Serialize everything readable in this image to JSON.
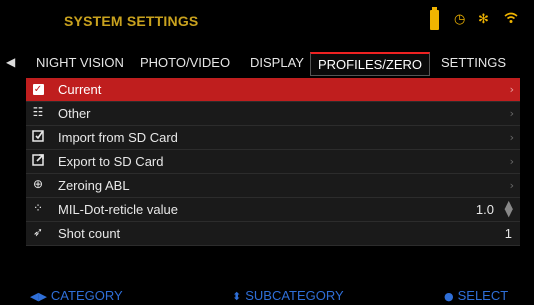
{
  "header": {
    "title": "SYSTEM SETTINGS",
    "icons": [
      "battery-icon",
      "timer-icon",
      "bluetooth-icon",
      "wifi-icon"
    ],
    "accent_color": "#f0b400"
  },
  "tabs": [
    {
      "label": "NIGHT VISION"
    },
    {
      "label": "PHOTO/VIDEO"
    },
    {
      "label": "DISPLAY"
    },
    {
      "label": "PROFILES/ZERO",
      "active": true
    },
    {
      "label": "SETTINGS"
    }
  ],
  "list": {
    "items": [
      {
        "label": "Current",
        "icon": "check-icon",
        "selected": true
      },
      {
        "label": "Other",
        "icon": "list-icon"
      },
      {
        "label": "Import from SD Card",
        "icon": "import-icon"
      },
      {
        "label": "Export to SD Card",
        "icon": "export-icon"
      },
      {
        "label": "Zeroing ABL",
        "icon": "zeroing-icon"
      },
      {
        "label": "MIL-Dot-reticle value",
        "icon": "reticle-icon",
        "value": "1.0"
      },
      {
        "label": "Shot count",
        "icon": "shot-count-icon",
        "value": "1"
      }
    ]
  },
  "footer": {
    "category": "CATEGORY",
    "subcategory": "SUBCATEGORY",
    "select": "SELECT",
    "color": "#2f6fd8"
  },
  "colors": {
    "selected_row": "#bf1e1e",
    "row_bg": "#1a1a1a",
    "tab_underline": "#e22222"
  }
}
